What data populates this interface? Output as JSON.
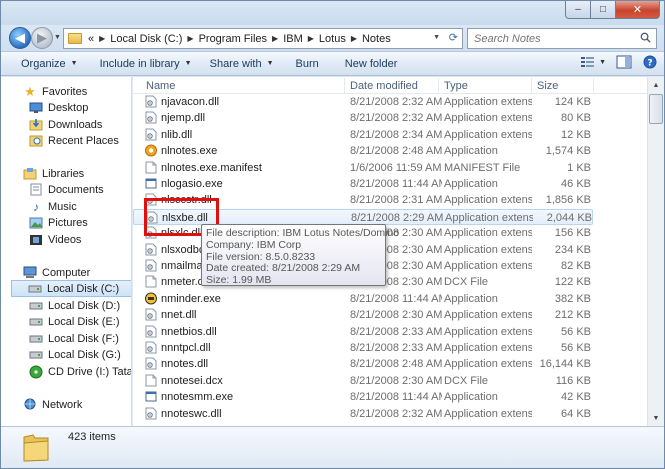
{
  "window": {
    "caption": {
      "minimize": "–",
      "maximize": "□",
      "close": "✕"
    }
  },
  "address": {
    "overflow": "«",
    "crumbs": [
      "Local Disk (C:)",
      "Program Files",
      "IBM",
      "Lotus",
      "Notes"
    ],
    "search_placeholder": "Search Notes"
  },
  "toolbar": {
    "organize": "Organize",
    "include_in_library": "Include in library",
    "share_with": "Share with",
    "burn": "Burn",
    "new_folder": "New folder"
  },
  "nav": {
    "favorites": {
      "label": "Favorites",
      "items": [
        "Desktop",
        "Downloads",
        "Recent Places"
      ]
    },
    "libraries": {
      "label": "Libraries",
      "items": [
        "Documents",
        "Music",
        "Pictures",
        "Videos"
      ]
    },
    "computer": {
      "label": "Computer",
      "items": [
        "Local Disk (C:)",
        "Local Disk (D:)",
        "Local Disk (E:)",
        "Local Disk (F:)",
        "Local Disk (G:)",
        "CD Drive (I:) Tata Ph"
      ]
    },
    "network": {
      "label": "Network"
    }
  },
  "columns": {
    "name": "Name",
    "date": "Date modified",
    "type": "Type",
    "size": "Size"
  },
  "files": [
    {
      "name": "njavacon.dll",
      "date": "8/21/2008 2:32 AM",
      "type": "Application extens...",
      "size": "124 KB",
      "icon": "dll"
    },
    {
      "name": "njemp.dll",
      "date": "8/21/2008 2:32 AM",
      "type": "Application extens...",
      "size": "80 KB",
      "icon": "dll"
    },
    {
      "name": "nlib.dll",
      "date": "8/21/2008 2:34 AM",
      "type": "Application extens...",
      "size": "12 KB",
      "icon": "dll"
    },
    {
      "name": "nlnotes.exe",
      "date": "8/21/2008 2:48 AM",
      "type": "Application",
      "size": "1,574 KB",
      "icon": "notes"
    },
    {
      "name": "nlnotes.exe.manifest",
      "date": "1/6/2006 11:59 AM",
      "type": "MANIFEST File",
      "size": "1 KB",
      "icon": "file"
    },
    {
      "name": "nlogasio.exe",
      "date": "8/21/2008 11:44 AM",
      "type": "Application",
      "size": "46 KB",
      "icon": "exe"
    },
    {
      "name": "nlsccstr.dll",
      "date": "8/21/2008 2:31 AM",
      "type": "Application extens...",
      "size": "1,856 KB",
      "icon": "dll"
    },
    {
      "name": "nlsxbe.dll",
      "date": "8/21/2008 2:29 AM",
      "type": "Application extens...",
      "size": "2,044 KB",
      "icon": "dll",
      "hover": true
    },
    {
      "name": "nlsxlc.dll",
      "date": "8/21/2008 2:30 AM",
      "type": "Application extens...",
      "size": "156 KB",
      "icon": "dll"
    },
    {
      "name": "nlsxodbc.dll",
      "date": "8/21/2008 2:30 AM",
      "type": "Application extens...",
      "size": "234 KB",
      "icon": "dll"
    },
    {
      "name": "nmailman.exe",
      "date": "8/21/2008 2:30 AM",
      "type": "Application extens...",
      "size": "82 KB",
      "icon": "dll"
    },
    {
      "name": "nmeter.dcx",
      "date": "8/21/2008 2:30 AM",
      "type": "DCX File",
      "size": "122 KB",
      "icon": "file"
    },
    {
      "name": "nminder.exe",
      "date": "8/21/2008 11:44 AM",
      "type": "Application",
      "size": "382 KB",
      "icon": "minder"
    },
    {
      "name": "nnet.dll",
      "date": "8/21/2008 2:30 AM",
      "type": "Application extens...",
      "size": "212 KB",
      "icon": "dll"
    },
    {
      "name": "nnetbios.dll",
      "date": "8/21/2008 2:33 AM",
      "type": "Application extens...",
      "size": "56 KB",
      "icon": "dll"
    },
    {
      "name": "nnntpcl.dll",
      "date": "8/21/2008 2:33 AM",
      "type": "Application extens...",
      "size": "56 KB",
      "icon": "dll"
    },
    {
      "name": "nnotes.dll",
      "date": "8/21/2008 2:48 AM",
      "type": "Application extens...",
      "size": "16,144 KB",
      "icon": "dll"
    },
    {
      "name": "nnotesei.dcx",
      "date": "8/21/2008 2:30 AM",
      "type": "DCX File",
      "size": "116 KB",
      "icon": "file"
    },
    {
      "name": "nnotesmm.exe",
      "date": "8/21/2008 11:44 AM",
      "type": "Application",
      "size": "42 KB",
      "icon": "exe"
    },
    {
      "name": "nnoteswc.dll",
      "date": "8/21/2008 2:32 AM",
      "type": "Application extens...",
      "size": "64 KB",
      "icon": "dll"
    }
  ],
  "tooltip": {
    "description": "File description: IBM Lotus Notes/Domino",
    "company": "Company: IBM Corp",
    "version": "File version: 8.5.0.8233",
    "created": "Date created: 8/21/2008 2:29 AM",
    "size": "Size: 1.99 MB"
  },
  "status": {
    "item_count": "423 items"
  },
  "colors": {
    "highlight": "#e01010",
    "accent": "#2a6fc1"
  }
}
